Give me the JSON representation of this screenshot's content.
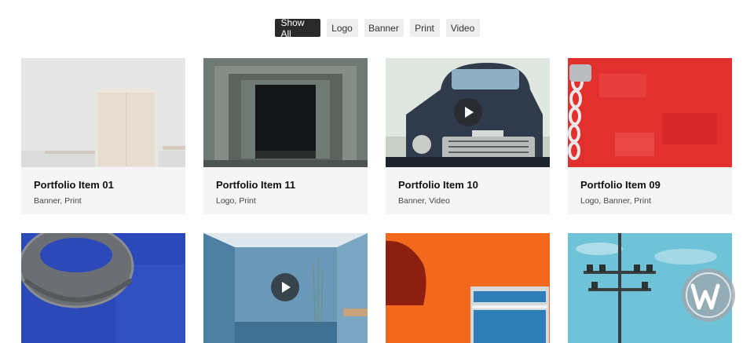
{
  "filters": [
    {
      "label": "Show All",
      "active": true
    },
    {
      "label": "Logo",
      "active": false
    },
    {
      "label": "Banner",
      "active": false
    },
    {
      "label": "Print",
      "active": false
    },
    {
      "label": "Video",
      "active": false
    }
  ],
  "items": [
    {
      "title": "Portfolio Item 01",
      "tags": "Banner, Print",
      "has_video": false
    },
    {
      "title": "Portfolio Item 11",
      "tags": "Logo, Print",
      "has_video": false
    },
    {
      "title": "Portfolio Item 10",
      "tags": "Banner, Video",
      "has_video": true
    },
    {
      "title": "Portfolio Item 09",
      "tags": "Logo, Banner, Print",
      "has_video": false
    },
    {
      "has_video": false
    },
    {
      "has_video": true
    },
    {
      "has_video": false
    },
    {
      "has_video": false
    }
  ],
  "colors": {
    "active_filter_bg": "#2a2a2a",
    "filter_bg": "#eeeeee",
    "card_bg": "#f5f5f5"
  },
  "icons": [
    "play-icon",
    "watermark-logo-icon"
  ]
}
